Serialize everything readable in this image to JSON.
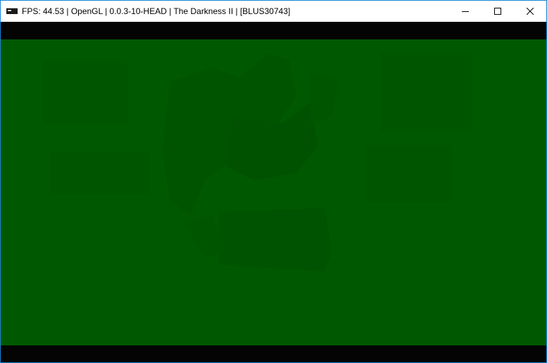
{
  "window": {
    "title": "FPS: 44.53 | OpenGL | 0.0.3-10-HEAD | The Darkness II | [BLUS30743]",
    "icon": "rpcs3-app-icon",
    "controls": {
      "minimize": "minimize-icon",
      "maximize": "maximize-icon",
      "close": "close-icon"
    }
  },
  "viewport": {
    "tint_color": "#005800",
    "letterbox_color": "#040404"
  }
}
